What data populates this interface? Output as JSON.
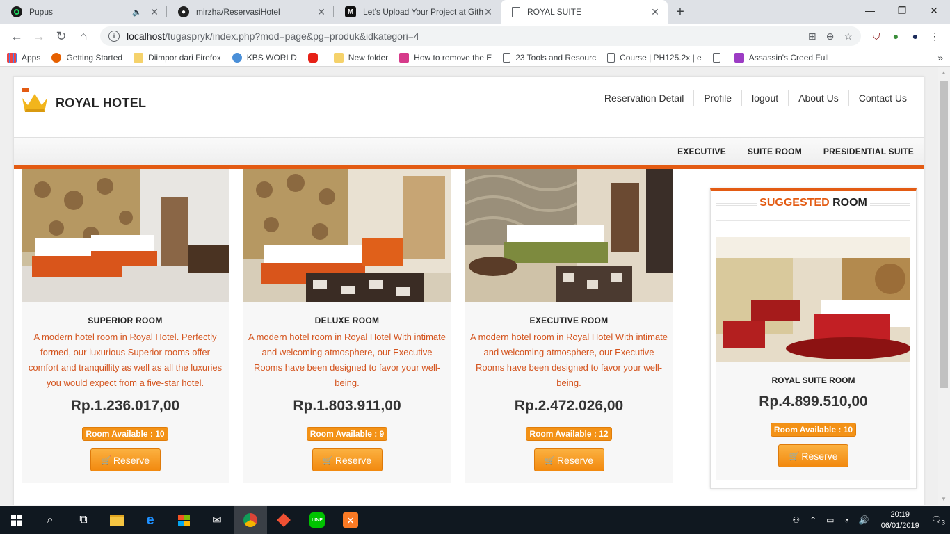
{
  "browser": {
    "tabs": [
      {
        "title": "Pupus",
        "icon": "spotify-icon",
        "active": false
      },
      {
        "title": "mirzha/ReservasiHotel",
        "icon": "github-icon",
        "active": false
      },
      {
        "title": "Let's Upload Your Project at Githu",
        "icon": "medium-icon",
        "active": false
      },
      {
        "title": "ROYAL SUITE",
        "icon": "page-icon",
        "active": true
      }
    ],
    "url_host": "localhost",
    "url_path": "/tugaspryk/index.php?mod=page&pg=produk&idkategori=4",
    "bookmarks": [
      {
        "label": "Apps",
        "color": "#4285f4"
      },
      {
        "label": "Getting Started",
        "color": "#e66000"
      },
      {
        "label": "Diimpor dari Firefox",
        "color": "#f5d26b"
      },
      {
        "label": "KBS WORLD",
        "color": "#4a8fd8"
      },
      {
        "label": "",
        "color": "#e62117"
      },
      {
        "label": "New folder",
        "color": "#f5d26b"
      },
      {
        "label": "How to remove the E",
        "color": "#d63a8a"
      },
      {
        "label": "23 Tools and Resourc",
        "color": "#ffffff"
      },
      {
        "label": "Course | PH125.2x | e",
        "color": "#ffffff"
      },
      {
        "label": "Assassin's Creed Full",
        "color": "#9c3cc4"
      }
    ]
  },
  "site": {
    "logo_text": "ROYAL HOTEL",
    "top_nav": [
      "Reservation Detail",
      "Profile",
      "logout",
      "About Us",
      "Contact Us"
    ],
    "category_nav": [
      "EXECUTIVE",
      "SUITE ROOM",
      "PRESIDENTIAL SUITE"
    ],
    "reserve_label": "Reserve",
    "rooms": [
      {
        "name": "SUPERIOR ROOM",
        "description": "A modern hotel room in Royal Hotel. Perfectly formed, our luxurious Superior rooms offer comfort and tranquillity as well as all the luxuries you would expect from a five-star hotel.",
        "price": "Rp.1.236.017,00",
        "availability": "Room Available : 10"
      },
      {
        "name": "DELUXE ROOM",
        "description": "A modern hotel room in Royal Hotel With intimate and welcoming atmosphere, our Executive Rooms have been designed to favor your well-being.",
        "price": "Rp.1.803.911,00",
        "availability": "Room Available : 9"
      },
      {
        "name": "EXECUTIVE ROOM",
        "description": "A modern hotel room in Royal Hotel With intimate and welcoming atmosphere, our Executive Rooms have been designed to favor your well-being.",
        "price": "Rp.2.472.026,00",
        "availability": "Room Available : 12"
      }
    ],
    "suggested": {
      "title_highlight": "SUGGESTED",
      "title_rest": " ROOM",
      "name": "ROYAL SUITE ROOM",
      "price": "Rp.4.899.510,00",
      "availability": "Room Available : 10"
    }
  },
  "taskbar": {
    "time": "20:19",
    "date": "06/01/2019",
    "notifications": "3"
  }
}
